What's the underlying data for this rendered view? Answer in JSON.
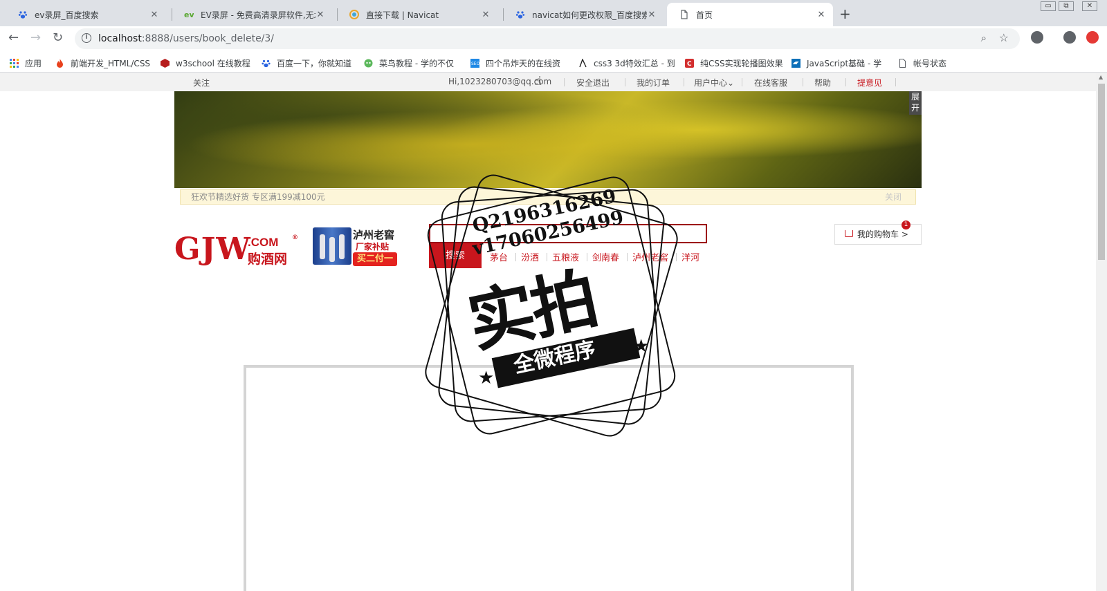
{
  "browser": {
    "tabs": [
      {
        "title": "ev录屏_百度搜索",
        "icon": "baidu-paw-icon"
      },
      {
        "title": "EV录屏 - 免费高清录屏软件,无水",
        "icon": "ev-logo-icon"
      },
      {
        "title": "直接下载 | Navicat",
        "icon": "navicat-icon"
      },
      {
        "title": "navicat如何更改权限_百度搜索",
        "icon": "baidu-paw-icon"
      },
      {
        "title": "首页",
        "icon": "page-icon"
      }
    ],
    "close_glyph": "✕",
    "new_tab_glyph": "+",
    "window_controls": [
      "▭",
      "⧉",
      "✕"
    ],
    "nav": {
      "back": "←",
      "forward": "→",
      "reload": "↻"
    },
    "url": {
      "host": "localhost",
      "path": ":8888/users/book_delete/3/"
    },
    "omnibox_icons": {
      "info": "i",
      "zoom": "⌕",
      "star": "☆"
    },
    "bookmarks": [
      {
        "label": "应用",
        "icon": "apps-grid-icon"
      },
      {
        "label": "前端开发_HTML/CSS",
        "icon": "fire-icon"
      },
      {
        "label": "w3school 在线教程",
        "icon": "w3school-icon"
      },
      {
        "label": "百度一下，你就知道",
        "icon": "baidu-paw-icon"
      },
      {
        "label": "菜鸟教程 - 学的不仅",
        "icon": "runoob-icon"
      },
      {
        "label": "四个吊炸天的在线资",
        "icon": "seo-icon"
      },
      {
        "label": "css3 3d特效汇总 - 到",
        "icon": "css3-icon"
      },
      {
        "label": "纯CSS实现轮播图效果",
        "icon": "c-logo-icon"
      },
      {
        "label": "JavaScript基础 - 学",
        "icon": "bird-icon"
      },
      {
        "label": "帐号状态",
        "icon": "document-icon"
      }
    ],
    "colors": {
      "tabbar": "#dee1e6",
      "omnibox": "#f1f3f4"
    }
  },
  "page": {
    "topnav": {
      "follow": "关注",
      "greeting": "Hi,1023280703@qq.com",
      "logout": "安全退出",
      "orders": "我的订单",
      "user_center": "用户中心",
      "chevron": "⌄",
      "service": "在线客服",
      "help": "帮助",
      "feedback": "提意见"
    },
    "banner": {
      "toggle": "展开"
    },
    "promo": {
      "text": "狂欢节精选好货 专区满199减100元",
      "close": "关闭"
    },
    "logo": {
      "main": "GJW",
      "com": ".COM",
      "reg": "®",
      "cn": "购酒网"
    },
    "ad": {
      "line1": "泸州老窖",
      "line2": "厂家补贴",
      "line3": "买二付一"
    },
    "search": {
      "button": "搜索",
      "value": ""
    },
    "hot_keywords": [
      "茅台",
      "汾酒",
      "五粮液",
      "剑南春",
      "泸州老窖",
      "洋河"
    ],
    "cart": {
      "label": "我的购物车 >",
      "count": "1"
    },
    "watermark": {
      "qq": "Q2196316269",
      "vx": "v17060256499",
      "big": "实拍",
      "ribbon": "全微程序",
      "star": "★"
    },
    "colors": {
      "brand_red": "#c8161d",
      "topnav_bg": "#f2f2f2",
      "promo_bg": "#fdf6d9"
    }
  }
}
